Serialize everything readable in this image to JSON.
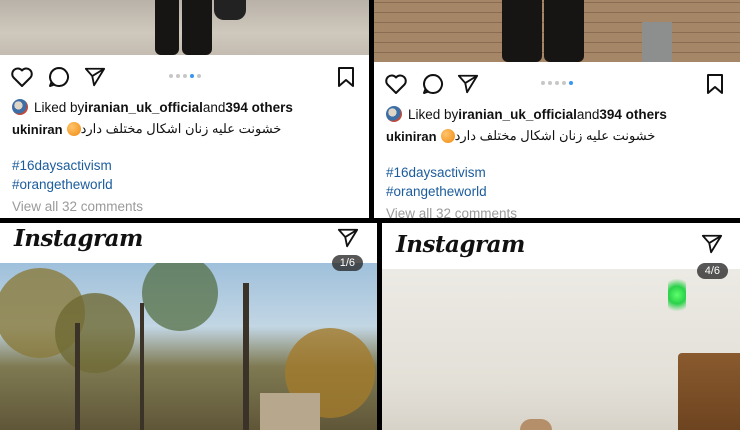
{
  "posts": [
    {
      "liked_prefix": "Liked by ",
      "liked_user": "iranian_uk_official",
      "liked_and": " and ",
      "liked_count": "394 others",
      "username": "ukiniran",
      "caption": "خشونت علیه زنان اشکال مختلف دارد",
      "tags": [
        "#16daysactivism",
        "#orangetheworld"
      ],
      "comments": "View all 32 comments",
      "carousel_dots": 5,
      "active_dot": 4
    },
    {
      "liked_prefix": "Liked by ",
      "liked_user": "iranian_uk_official",
      "liked_and": " and ",
      "liked_count": "394 others",
      "username": "ukiniran",
      "caption": "خشونت علیه زنان اشکال مختلف دارد",
      "tags": [
        "#16daysactivism",
        "#orangetheworld"
      ],
      "comments": "View all 32 comments",
      "carousel_dots": 5,
      "active_dot": 5
    }
  ],
  "headers": [
    {
      "logo": "Instagram",
      "counter": "1/6"
    },
    {
      "logo": "Instagram",
      "counter": "4/6"
    }
  ],
  "icons": {
    "like": "heart-icon",
    "comment": "comment-icon",
    "share": "send-icon",
    "save": "bookmark-icon"
  },
  "colors": {
    "hashtag": "#1b5c9c",
    "active_dot": "#3897f0",
    "comments": "#9a9a9a"
  }
}
